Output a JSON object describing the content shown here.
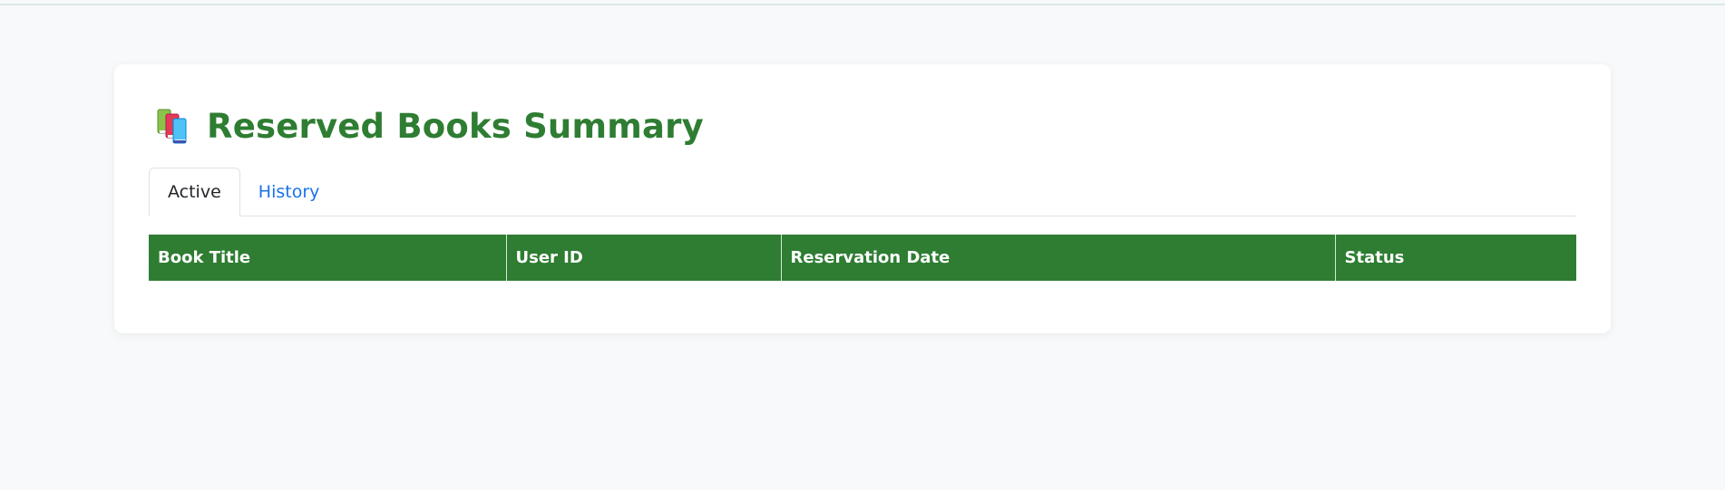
{
  "page": {
    "title": "Reserved Books Summary",
    "title_icon": "books-icon",
    "accent_color": "#2e7d32",
    "link_color": "#1a73e8"
  },
  "tabs": [
    {
      "label": "Active",
      "active": true
    },
    {
      "label": "History",
      "active": false
    }
  ],
  "table": {
    "columns": [
      "Book Title",
      "User ID",
      "Reservation Date",
      "Status"
    ],
    "rows": []
  }
}
